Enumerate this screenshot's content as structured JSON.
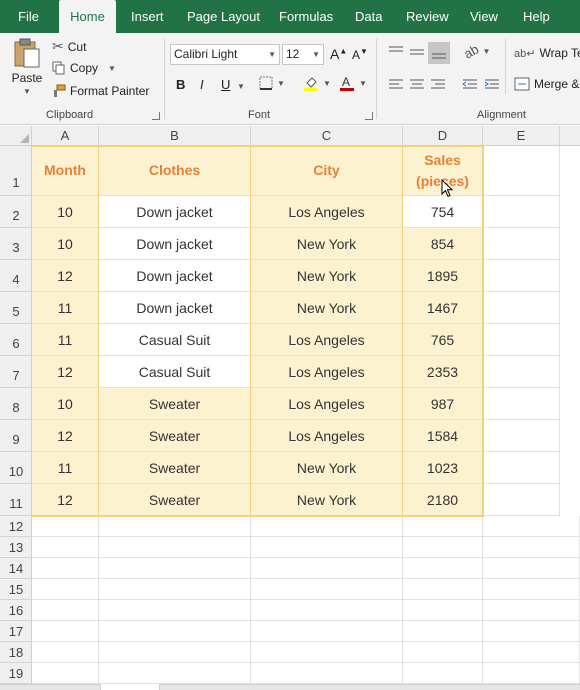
{
  "tabs": [
    "File",
    "Home",
    "Insert",
    "Page Layout",
    "Formulas",
    "Data",
    "Review",
    "View",
    "Help"
  ],
  "clipboard": {
    "paste_label": "Paste",
    "cut_label": "Cut",
    "copy_label": "Copy",
    "format_painter_label": "Format Painter",
    "group_label": "Clipboard"
  },
  "font": {
    "font_name": "Calibri Light",
    "font_size": "12",
    "group_label": "Font",
    "bold": "B",
    "italic": "I",
    "underline": "U",
    "font_color": "#c00000",
    "fill_color": "#ffff00"
  },
  "alignment": {
    "wrap_text_label": "Wrap Tex",
    "merge_label": "Merge &",
    "group_label": "Alignment"
  },
  "columns": [
    "A",
    "B",
    "C",
    "D",
    "E"
  ],
  "rows": [
    "1",
    "2",
    "3",
    "4",
    "5",
    "6",
    "7",
    "8",
    "9",
    "10",
    "11",
    "12",
    "13",
    "14",
    "15",
    "16",
    "17",
    "18",
    "19"
  ],
  "table": {
    "header_color": "#e8803a",
    "fill_color": "#fdf2d0",
    "headers": [
      "Month",
      "Clothes",
      "City",
      "Sales\n(pieces)"
    ],
    "header_sales_line1": "Sales",
    "header_sales_line2": "(pieces)",
    "data": [
      [
        "10",
        "Down jacket",
        "Los Angeles",
        "754"
      ],
      [
        "10",
        "Down jacket",
        "New York",
        "854"
      ],
      [
        "12",
        "Down jacket",
        "New York",
        "1895"
      ],
      [
        "11",
        "Down jacket",
        "New York",
        "1467"
      ],
      [
        "11",
        "Casual Suit",
        "Los Angeles",
        "765"
      ],
      [
        "12",
        "Casual Suit",
        "Los Angeles",
        "2353"
      ],
      [
        "10",
        "Sweater",
        "Los Angeles",
        "987"
      ],
      [
        "12",
        "Sweater",
        "Los Angeles",
        "1584"
      ],
      [
        "11",
        "Sweater",
        "New York",
        "1023"
      ],
      [
        "12",
        "Sweater",
        "New York",
        "2180"
      ]
    ]
  }
}
